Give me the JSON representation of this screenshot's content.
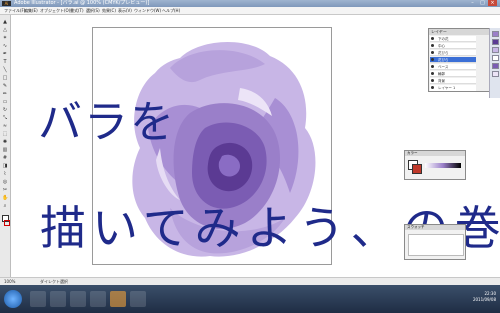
{
  "window": {
    "title": "Adobe Illustrator - [バラ.ai @ 100% (CMYK/プレビュー)]",
    "logo": "Ai"
  },
  "menu": [
    "ファイル(F)",
    "編集(E)",
    "オブジェクト(O)",
    "書式(T)",
    "選択(S)",
    "効果(C)",
    "表示(V)",
    "ウィンドウ(W)",
    "ヘルプ(H)"
  ],
  "overlay": {
    "line1": "バラを",
    "line2": "描いてみよう、の巻"
  },
  "layers_panel": {
    "title": "レイヤー",
    "items": [
      "下の花",
      "中心",
      "花びら",
      "花びら",
      "ベース",
      "輪郭",
      "背景",
      "レイヤー 1"
    ],
    "selected_index": 3
  },
  "panel2": {
    "title": "カラー"
  },
  "panel3": {
    "title": "スウォッチ"
  },
  "status": {
    "zoom": "100%",
    "info": "ダイレクト選択"
  },
  "taskbar": {
    "time": "22:30",
    "date": "2011/09/08"
  },
  "colors": {
    "overlay_text": "#1f2a8a",
    "rose_light": "#c8b6e6",
    "rose_mid": "#9a7fc9",
    "rose_dark": "#5b3a93"
  }
}
